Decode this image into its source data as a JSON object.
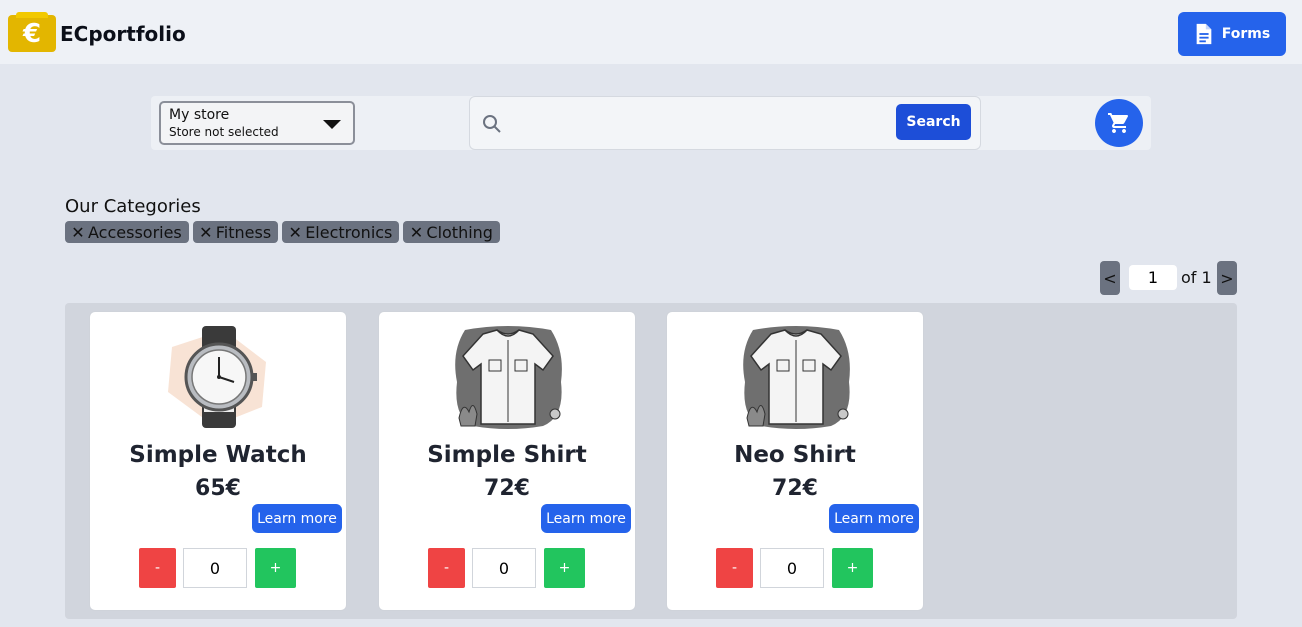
{
  "header": {
    "brand": "ECportfolio",
    "logo_glyph": "€",
    "forms_label": "Forms",
    "logo_icon": "euro-folder-icon",
    "forms_icon": "document-icon"
  },
  "toolbar": {
    "store_label": "My store",
    "store_value": "Store not selected",
    "search_placeholder": "",
    "search_value": "",
    "search_label": "Search",
    "cart_icon": "shopping-cart-icon"
  },
  "categories": {
    "title": "Our Categories",
    "items": [
      {
        "label": "Accessories"
      },
      {
        "label": "Fitness"
      },
      {
        "label": "Electronics"
      },
      {
        "label": "Clothing"
      }
    ]
  },
  "pagination": {
    "prev": "<",
    "next": ">",
    "current": "1",
    "of_label": "of 1"
  },
  "products": [
    {
      "name": "Simple Watch",
      "price": "65€",
      "learn": "Learn more",
      "minus": "-",
      "qty": "0",
      "plus": "+",
      "image": "watch-image"
    },
    {
      "name": "Simple Shirt",
      "price": "72€",
      "learn": "Learn more",
      "minus": "-",
      "qty": "0",
      "plus": "+",
      "image": "shirt-image"
    },
    {
      "name": "Neo Shirt",
      "price": "72€",
      "learn": "Learn more",
      "minus": "-",
      "qty": "0",
      "plus": "+",
      "image": "shirt-image"
    }
  ],
  "colors": {
    "primary": "#2563eb",
    "logo": "#e3b600",
    "minus": "#ef4444",
    "plus": "#22c55e",
    "chip": "#6b7280"
  }
}
